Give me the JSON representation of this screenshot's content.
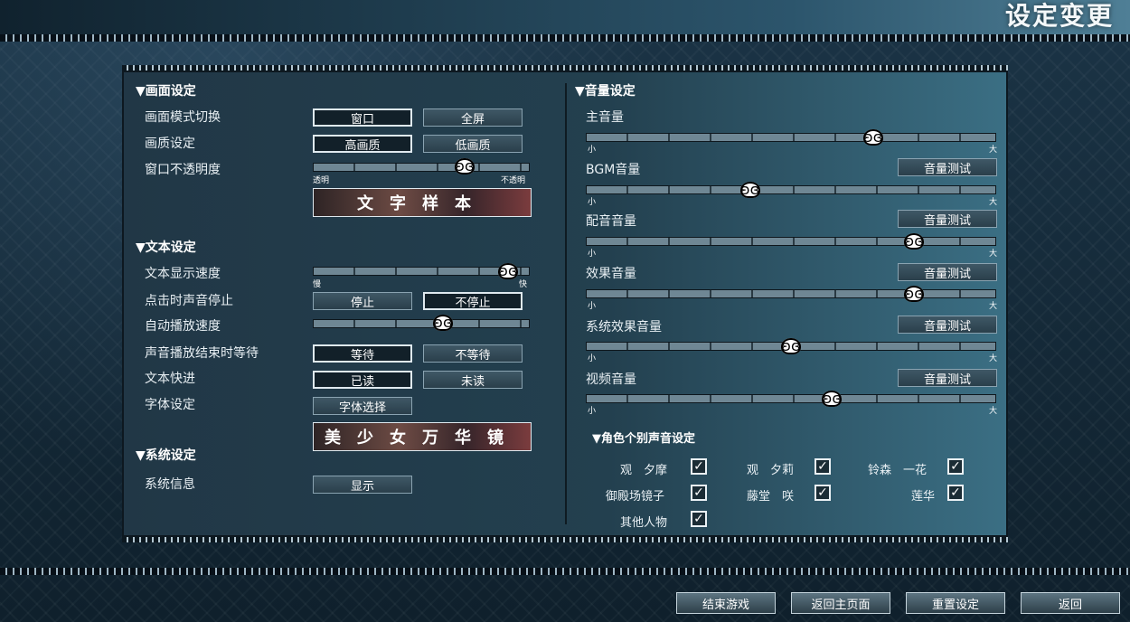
{
  "title": "设定变更",
  "display": {
    "section": "▼画面设定",
    "mode_label": "画面模式切换",
    "mode_options": [
      "窗口",
      "全屏"
    ],
    "quality_label": "画质设定",
    "quality_options": [
      "高画质",
      "低画质"
    ],
    "opacity_label": "窗口不透明度",
    "opacity_min": "透明",
    "opacity_max": "不透明",
    "opacity_value": 0.7,
    "sample_text": "文字样本"
  },
  "text": {
    "section": "▼文本设定",
    "speed_label": "文本显示速度",
    "speed_min": "慢",
    "speed_max": "快",
    "speed_value": 0.9,
    "click_label": "点击时声音停止",
    "click_options": [
      "停止",
      "不停止"
    ],
    "auto_label": "自动播放速度",
    "auto_value": 0.6,
    "wait_label": "声音播放结束时等待",
    "wait_options": [
      "等待",
      "不等待"
    ],
    "skip_label": "文本快进",
    "skip_options": [
      "已读",
      "未读"
    ],
    "font_label": "字体设定",
    "font_button": "字体选择",
    "font_sample": "美少女万华镜"
  },
  "system": {
    "section": "▼系统设定",
    "info_label": "系统信息",
    "info_button": "显示"
  },
  "audio": {
    "section": "▼音量设定",
    "min": "小",
    "max": "大",
    "test_label": "音量测试",
    "items": [
      {
        "label": "主音量",
        "value": 0.7
      },
      {
        "label": "BGM音量",
        "value": 0.4
      },
      {
        "label": "配音音量",
        "value": 0.8
      },
      {
        "label": "效果音量",
        "value": 0.8
      },
      {
        "label": "系统效果音量",
        "value": 0.5
      },
      {
        "label": "视频音量",
        "value": 0.6
      }
    ]
  },
  "characters": {
    "section": "▼角色个别声音设定",
    "names": [
      "观　夕摩",
      "观　夕莉",
      "铃森　一花",
      "御殿场镜子",
      "藤堂　咲",
      "莲华",
      "其他人物"
    ],
    "checked": [
      true,
      true,
      true,
      true,
      true,
      true,
      true
    ]
  },
  "footer": {
    "end": "结束游戏",
    "back_title": "返回主页面",
    "reset": "重置设定",
    "back": "返回"
  }
}
